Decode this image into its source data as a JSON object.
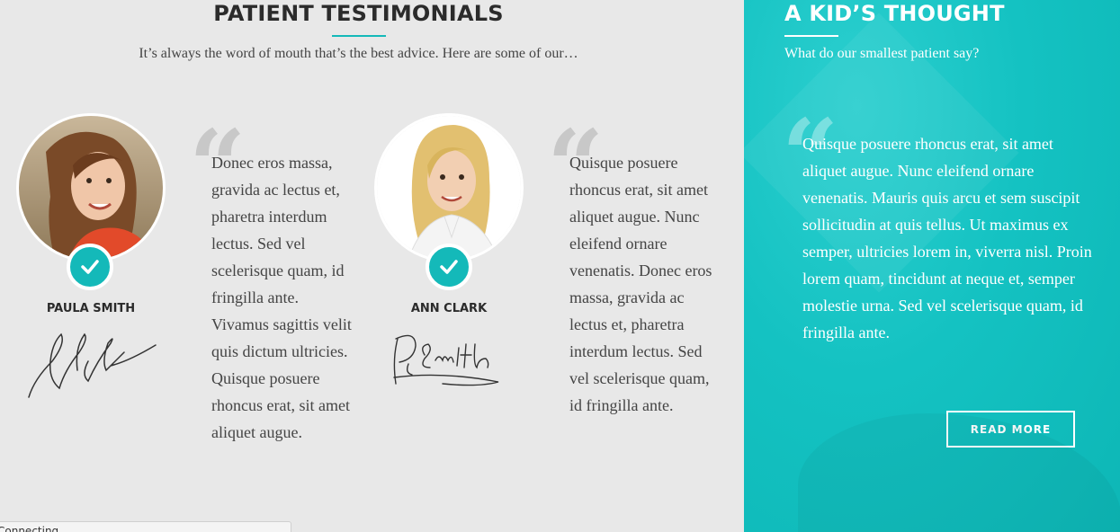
{
  "testimonials_section": {
    "title": "PATIENT TESTIMONIALS",
    "subtitle": "It’s always the word of mouth that’s the best advice. Here are some of our…",
    "testimonials": [
      {
        "name": "PAULA SMITH",
        "quote": "Donec eros massa, gravida ac lectus et, pharetra interdum lectus. Sed vel scelerisque quam, id fringilla ante. Vivamus sagittis velit quis dictum ultricies. Quisque posuere rhoncus erat, sit amet aliquet augue."
      },
      {
        "name": "ANN CLARK",
        "quote": "Quisque posuere rhoncus erat, sit amet aliquet augue. Nunc eleifend ornare venenatis. Donec eros massa, gravida ac lectus et, pharetra interdum lectus. Sed vel scelerisque quam, id fringilla ante."
      }
    ],
    "quote_glyph": "“",
    "check_icon": "check-icon"
  },
  "kid_section": {
    "title": "A KID’S THOUGHT",
    "subtitle": "What do our smallest patient say?",
    "quote": "Quisque posuere rhoncus erat, sit amet aliquet augue. Nunc eleifend ornare venenatis. Mauris quis arcu et sem suscipit sollicitudin at quis tellus. Ut maximus ex semper, ultricies lorem in, viverra nisl. Proin lorem quam, tincidunt at neque et, semper molestie urna. Sed vel scelerisque quam, id fringilla ante.",
    "quote_glyph": "“",
    "button_label": "READ MORE"
  },
  "status_bar": {
    "text": "Connecting..."
  },
  "colors": {
    "accent": "#14b9b9",
    "panel": "#e8e8e8",
    "text": "#444444",
    "heading": "#2b2b2b"
  }
}
